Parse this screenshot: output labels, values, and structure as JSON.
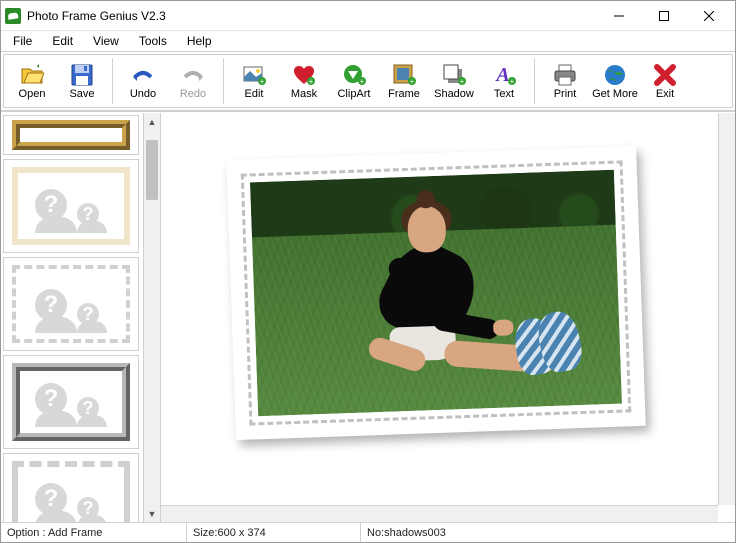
{
  "window": {
    "title": "Photo Frame Genius V2.3"
  },
  "menu": {
    "items": [
      "File",
      "Edit",
      "View",
      "Tools",
      "Help"
    ]
  },
  "toolbar": {
    "open": "Open",
    "save": "Save",
    "undo": "Undo",
    "redo": "Redo",
    "edit": "Edit",
    "mask": "Mask",
    "clipart": "ClipArt",
    "frame": "Frame",
    "shadow": "Shadow",
    "text": "Text",
    "print": "Print",
    "getmore": "Get More",
    "exit": "Exit"
  },
  "sidebar": {
    "frames": [
      {
        "id": "gold",
        "style": "frame-gold"
      },
      {
        "id": "cream",
        "style": "frame-cream"
      },
      {
        "id": "stamp",
        "style": "frame-stamp"
      },
      {
        "id": "silver",
        "style": "frame-silver"
      },
      {
        "id": "grey",
        "style": "frame-grey"
      }
    ]
  },
  "status": {
    "option": "Option : Add Frame",
    "size": "Size:600 x 374",
    "no": "No:shadows003"
  }
}
